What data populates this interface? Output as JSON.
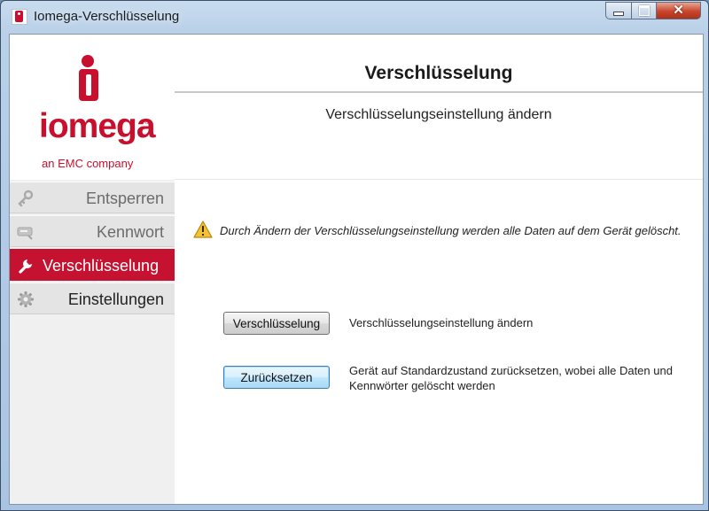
{
  "window": {
    "title": "Iomega-Verschlüsselung",
    "controls": {
      "minimize": "minimize-icon",
      "maximize": "maximize-icon",
      "close": "close-icon"
    }
  },
  "logo": {
    "wordmark": "iomega",
    "trademark": "®",
    "tagline": "an EMC company",
    "brand_color": "#c8102e"
  },
  "sidebar": {
    "items": [
      {
        "label": "Entsperren",
        "icon": "key-icon",
        "active": false
      },
      {
        "label": "Kennwort",
        "icon": "password-icon",
        "active": false
      },
      {
        "label": "Verschlüsselung",
        "icon": "wrench-icon",
        "active": true
      },
      {
        "label": "Einstellungen",
        "icon": "gear-icon",
        "active": false
      }
    ],
    "active_color": "#c41230"
  },
  "header": {
    "title": "Verschlüsselung",
    "subtitle": "Verschlüsselungseinstellung ändern"
  },
  "content": {
    "warning": "Durch Ändern der Verschlüsselungseinstellung werden alle Daten auf dem Gerät gelöscht.",
    "actions": [
      {
        "button": "Verschlüsselung",
        "description": "Verschlüsselungseinstellung ändern"
      },
      {
        "button": "Zurücksetzen",
        "description": "Gerät auf Standardzustand zurücksetzen, wobei alle Daten und Kennwörter gelöscht werden"
      }
    ]
  }
}
